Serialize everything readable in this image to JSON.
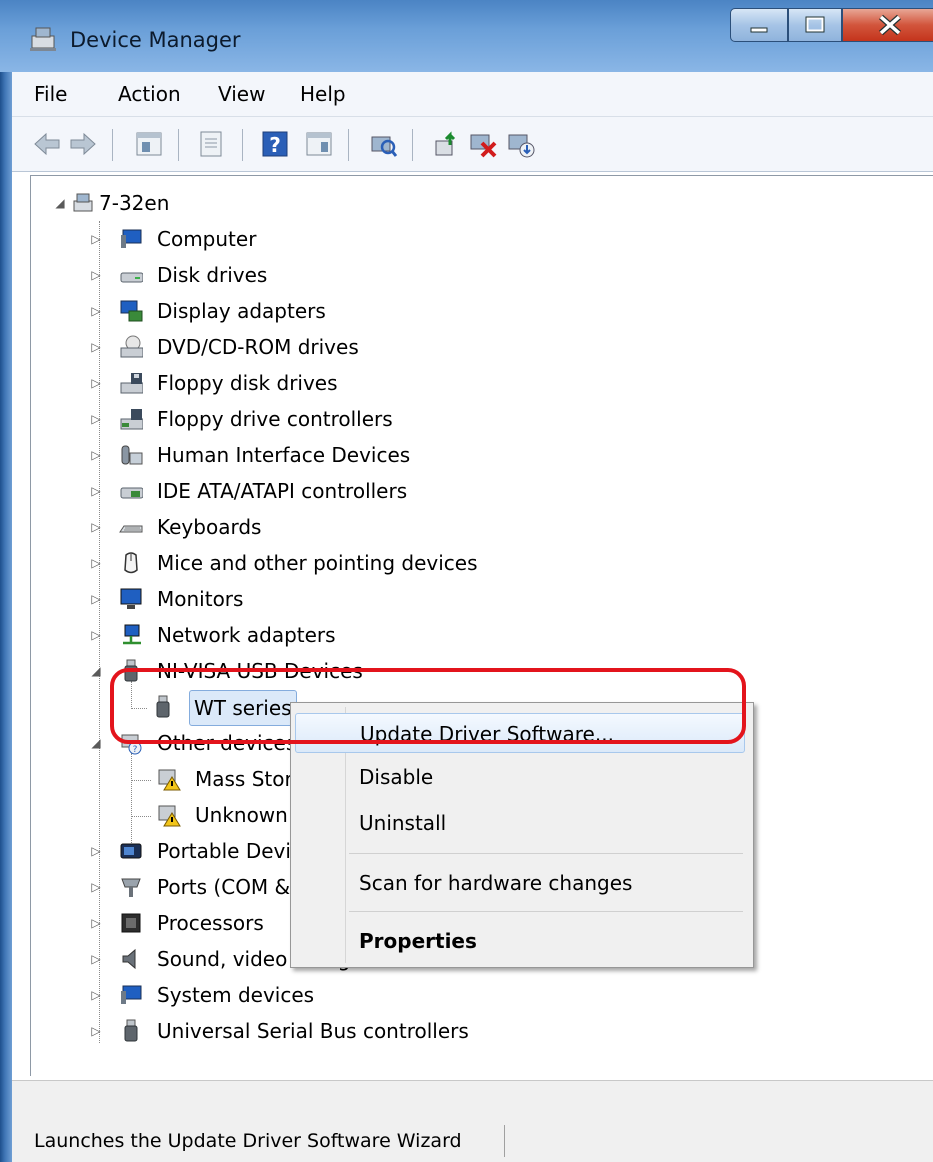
{
  "window": {
    "title": "Device Manager",
    "controls": {
      "minimize": "minimize",
      "maximize": "maximize",
      "close": "close"
    }
  },
  "menubar": {
    "items": [
      "File",
      "Action",
      "View",
      "Help"
    ]
  },
  "toolbar": {
    "buttons": [
      "back-arrow-icon",
      "forward-arrow-icon",
      "show-hide-console-tree-icon",
      "properties-icon",
      "help-icon",
      "action-pane-icon",
      "scan-hardware-icon",
      "update-driver-icon",
      "uninstall-icon",
      "enable-icon"
    ]
  },
  "tree": {
    "root": "7-32en",
    "items": [
      {
        "label": "Computer",
        "icon": "computer-icon"
      },
      {
        "label": "Disk drives",
        "icon": "disk-drive-icon"
      },
      {
        "label": "Display adapters",
        "icon": "display-adapter-icon"
      },
      {
        "label": "DVD/CD-ROM drives",
        "icon": "dvd-drive-icon"
      },
      {
        "label": "Floppy disk drives",
        "icon": "floppy-icon"
      },
      {
        "label": "Floppy drive controllers",
        "icon": "floppy-controller-icon"
      },
      {
        "label": "Human Interface Devices",
        "icon": "hid-icon"
      },
      {
        "label": "IDE ATA/ATAPI controllers",
        "icon": "ide-icon"
      },
      {
        "label": "Keyboards",
        "icon": "keyboard-icon"
      },
      {
        "label": "Mice and other pointing devices",
        "icon": "mouse-icon"
      },
      {
        "label": "Monitors",
        "icon": "monitor-icon"
      },
      {
        "label": "Network adapters",
        "icon": "network-adapter-icon"
      },
      {
        "label": "NI-VISA USB Devices",
        "icon": "usb-device-icon",
        "expanded": true
      },
      {
        "label": "WT series",
        "icon": "usb-plug-icon",
        "child": true,
        "selected": true
      },
      {
        "label": "Other devices",
        "icon": "other-devices-icon",
        "expanded": true
      },
      {
        "label": "Mass Storage Controller",
        "icon": "warning-device-icon",
        "child": true
      },
      {
        "label": "Unknown device",
        "icon": "warning-device-icon",
        "child": true
      },
      {
        "label": "Portable Devices",
        "icon": "portable-device-icon"
      },
      {
        "label": "Ports (COM & LPT)",
        "icon": "port-icon"
      },
      {
        "label": "Processors",
        "icon": "processor-icon"
      },
      {
        "label": "Sound, video and game controllers",
        "icon": "sound-icon"
      },
      {
        "label": "System devices",
        "icon": "system-devices-icon"
      },
      {
        "label": "Universal Serial Bus controllers",
        "icon": "usb-controller-icon"
      }
    ]
  },
  "context_menu": {
    "items": [
      "Update Driver Software...",
      "Disable",
      "Uninstall",
      "Scan for hardware changes",
      "Properties"
    ]
  },
  "status_bar": {
    "text": "Launches the Update Driver Software Wizard"
  },
  "colors": {
    "title_bar": "#6a9fd8",
    "selection": "#dbe9f9",
    "annotation": "#e3141c",
    "close_button": "#d2553c"
  }
}
